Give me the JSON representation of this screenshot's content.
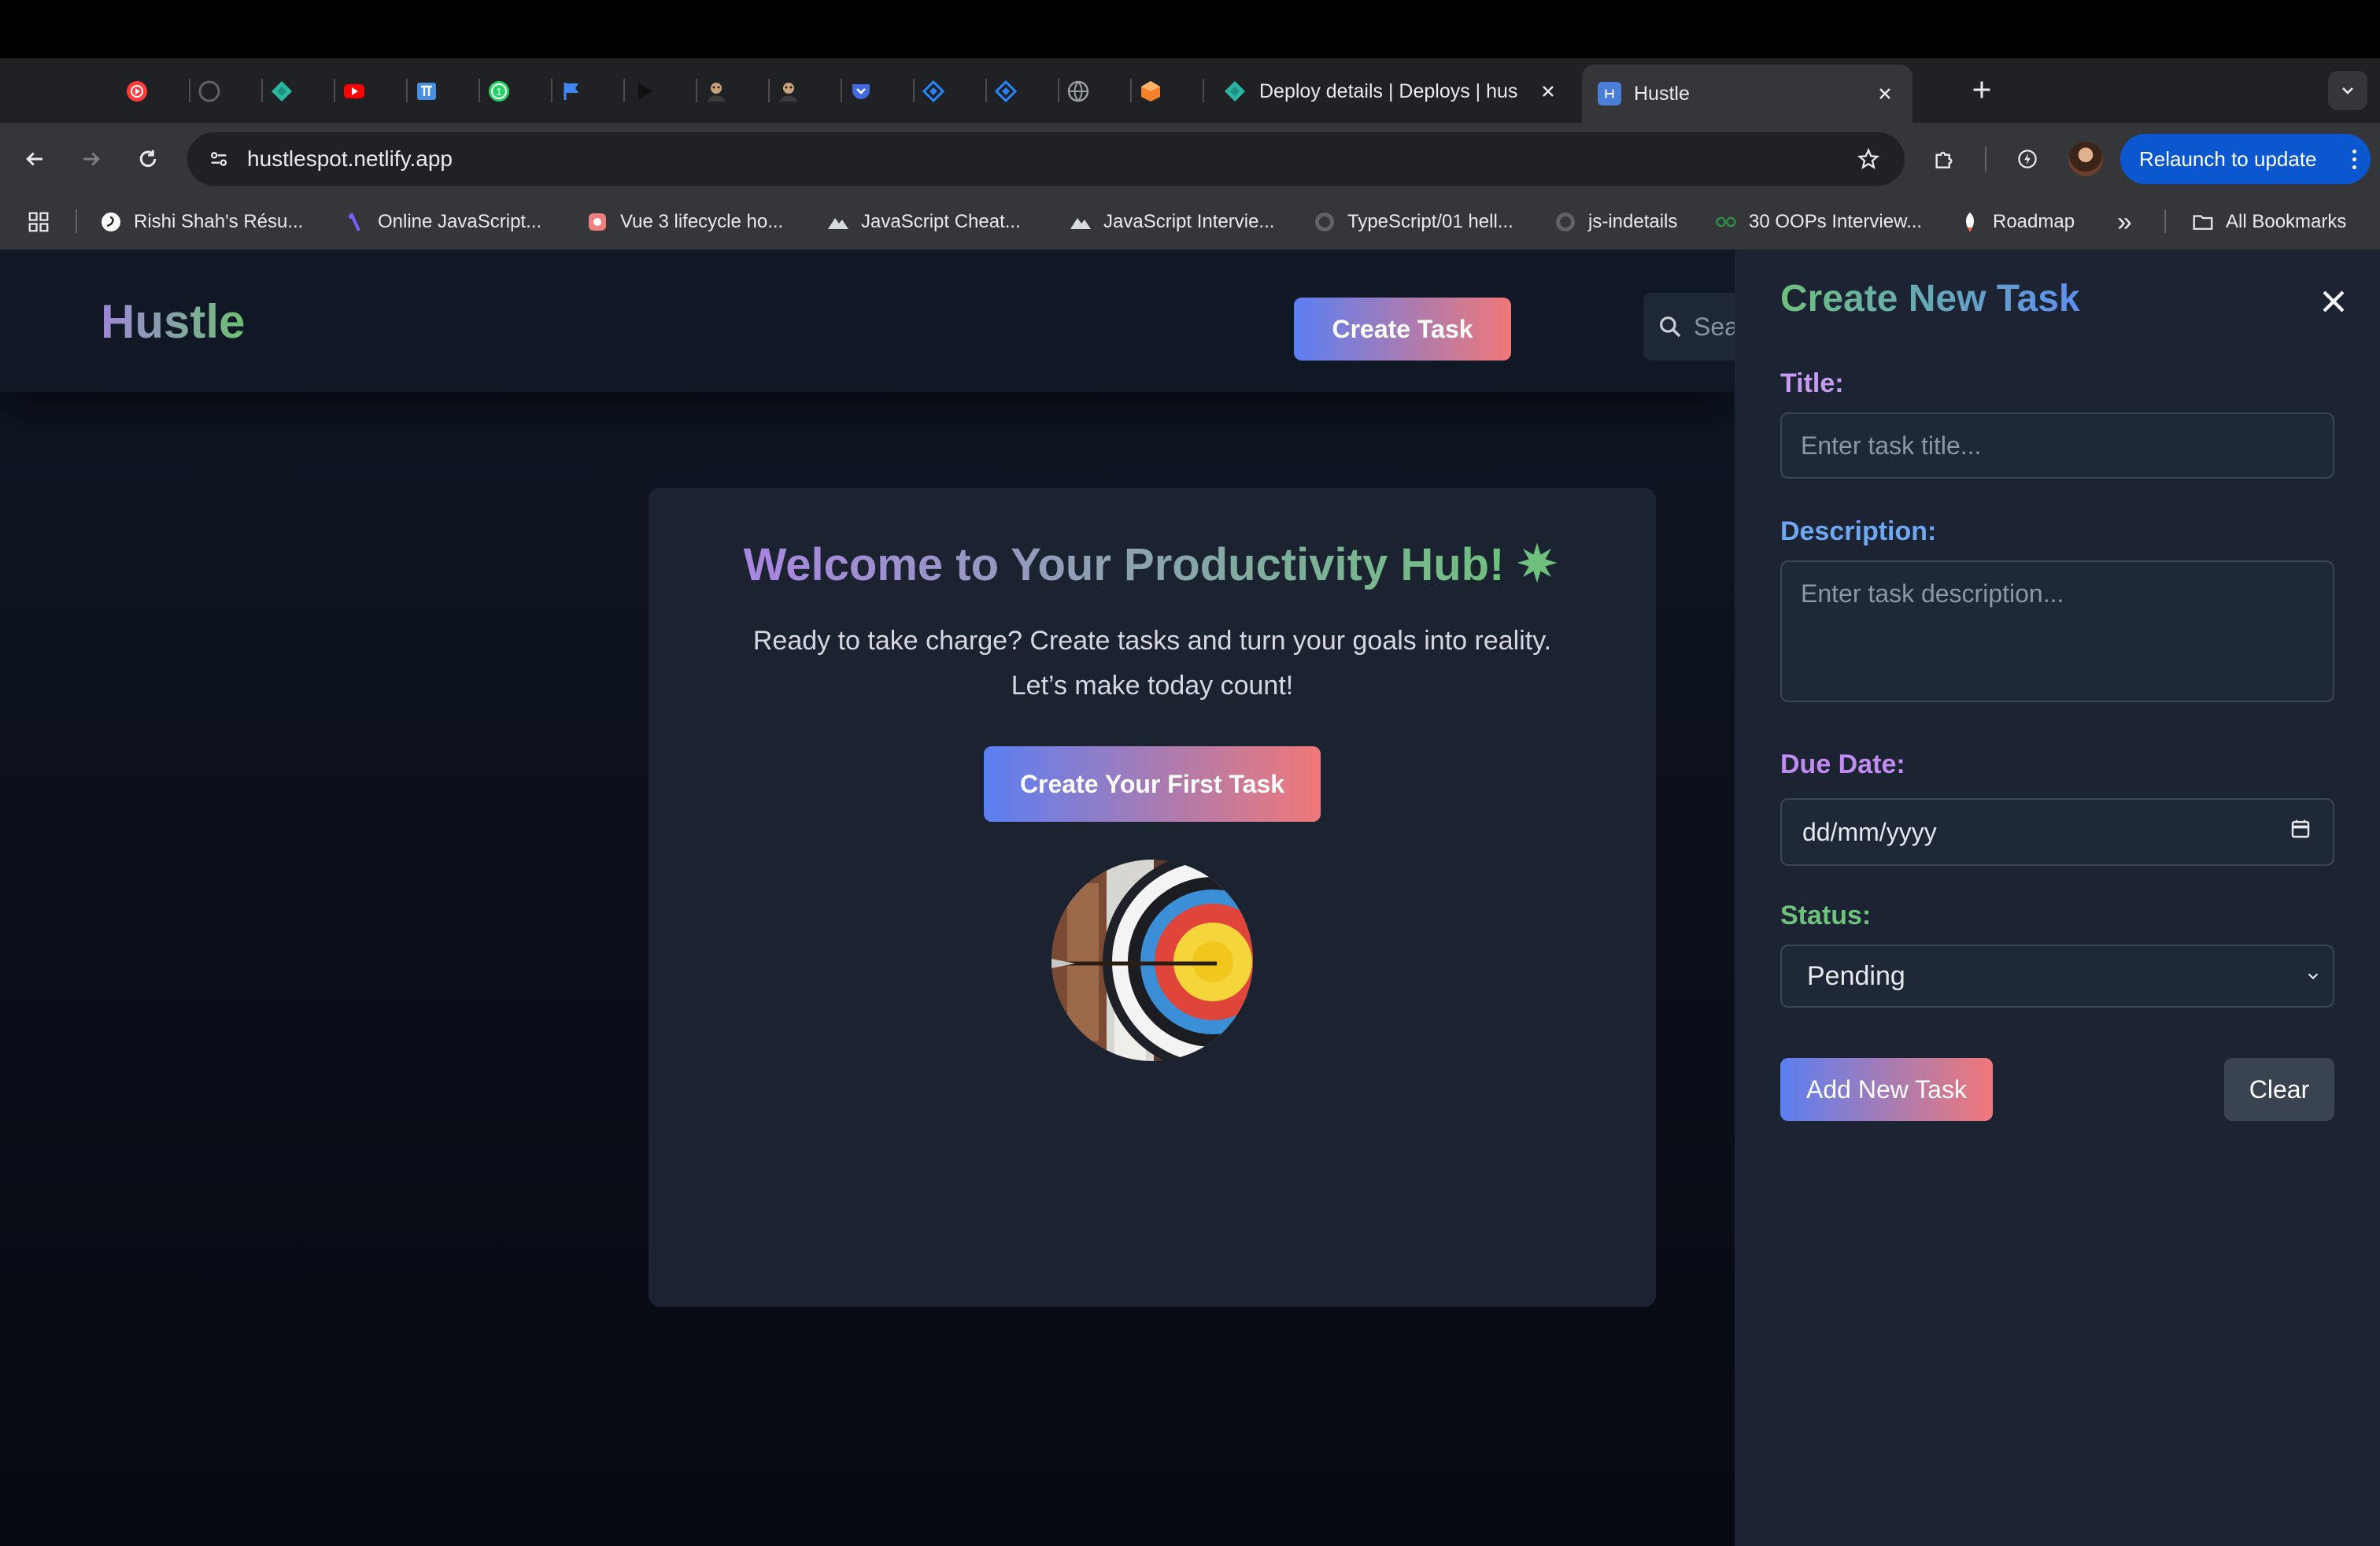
{
  "browser": {
    "pinned_tabs": [
      {
        "icon": "youtube-music-icon",
        "color": "#ff3d3d"
      },
      {
        "icon": "github-icon",
        "color": "#5f6368"
      },
      {
        "icon": "netlify-icon",
        "color": "#2bb6a3"
      },
      {
        "icon": "youtube-icon",
        "color": "#ff0000"
      },
      {
        "icon": "monkeytype-icon",
        "color": "#4a90e2"
      },
      {
        "icon": "whatsapp-icon",
        "color": "#25d366"
      },
      {
        "icon": "flag-icon",
        "color": "#4285f4"
      },
      {
        "icon": "play-icon",
        "color": "#000000"
      },
      {
        "icon": "avatar-icon",
        "color": "#c9a37b"
      },
      {
        "icon": "avatar-icon",
        "color": "#c9a37b"
      },
      {
        "icon": "pocket-icon",
        "color": "#4169e1"
      },
      {
        "icon": "jira-icon",
        "color": "#2684ff"
      },
      {
        "icon": "jira-icon",
        "color": "#2684ff"
      },
      {
        "icon": "globe-icon",
        "color": "#9aa0a6"
      },
      {
        "icon": "box-icon",
        "color": "#f4812a"
      }
    ],
    "tabs": [
      {
        "title": "Deploy details | Deploys | hus",
        "icon": "netlify-icon"
      },
      {
        "title": "Hustle",
        "icon": "app-icon",
        "active": true
      }
    ],
    "url": "hustlespot.netlify.app",
    "relaunch_label": "Relaunch to update",
    "bookmarks": [
      {
        "label": "Rishi Shah's Résu...",
        "icon": "resume-icon"
      },
      {
        "label": "Online JavaScript...",
        "icon": "code-icon"
      },
      {
        "label": "Vue 3 lifecycle ho...",
        "icon": "vue-icon"
      },
      {
        "label": "JavaScript Cheat...",
        "icon": "mountain-icon"
      },
      {
        "label": "JavaScript Intervie...",
        "icon": "mountain-icon"
      },
      {
        "label": "TypeScript/01 hell...",
        "icon": "github-icon"
      },
      {
        "label": "js-indetails",
        "icon": "github-icon"
      },
      {
        "label": "30 OOPs Interview...",
        "icon": "gfg-icon"
      },
      {
        "label": "Roadmap",
        "icon": "rocket-icon"
      }
    ],
    "more_bookmarks": "»",
    "all_bookmarks_label": "All Bookmarks"
  },
  "app": {
    "logo": "Hustle",
    "create_task_label": "Create Task",
    "search_placeholder": "Sea",
    "welcome": {
      "title": "Welcome to Your Productivity Hub!",
      "subtitle_line1": "Ready to take charge? Create tasks and turn your goals into reality.",
      "subtitle_line2": "Let’s make today count!",
      "cta_label": "Create Your First Task"
    },
    "panel": {
      "title": "Create New Task",
      "title_label": "Title:",
      "title_placeholder": "Enter task title...",
      "title_value": "",
      "description_label": "Description:",
      "description_placeholder": "Enter task description...",
      "description_value": "",
      "due_date_label": "Due Date:",
      "due_date_value": "dd/mm/yyyy",
      "status_label": "Status:",
      "status_value": "Pending",
      "add_label": "Add New Task",
      "clear_label": "Clear"
    }
  },
  "colors": {
    "accent_gradient_start": "#5b7ff2",
    "accent_gradient_end": "#f07878",
    "title_label": "#c59cf2",
    "description_label": "#6fa8f0",
    "due_date_label": "#c08cf0",
    "status_label": "#6fc07d"
  }
}
